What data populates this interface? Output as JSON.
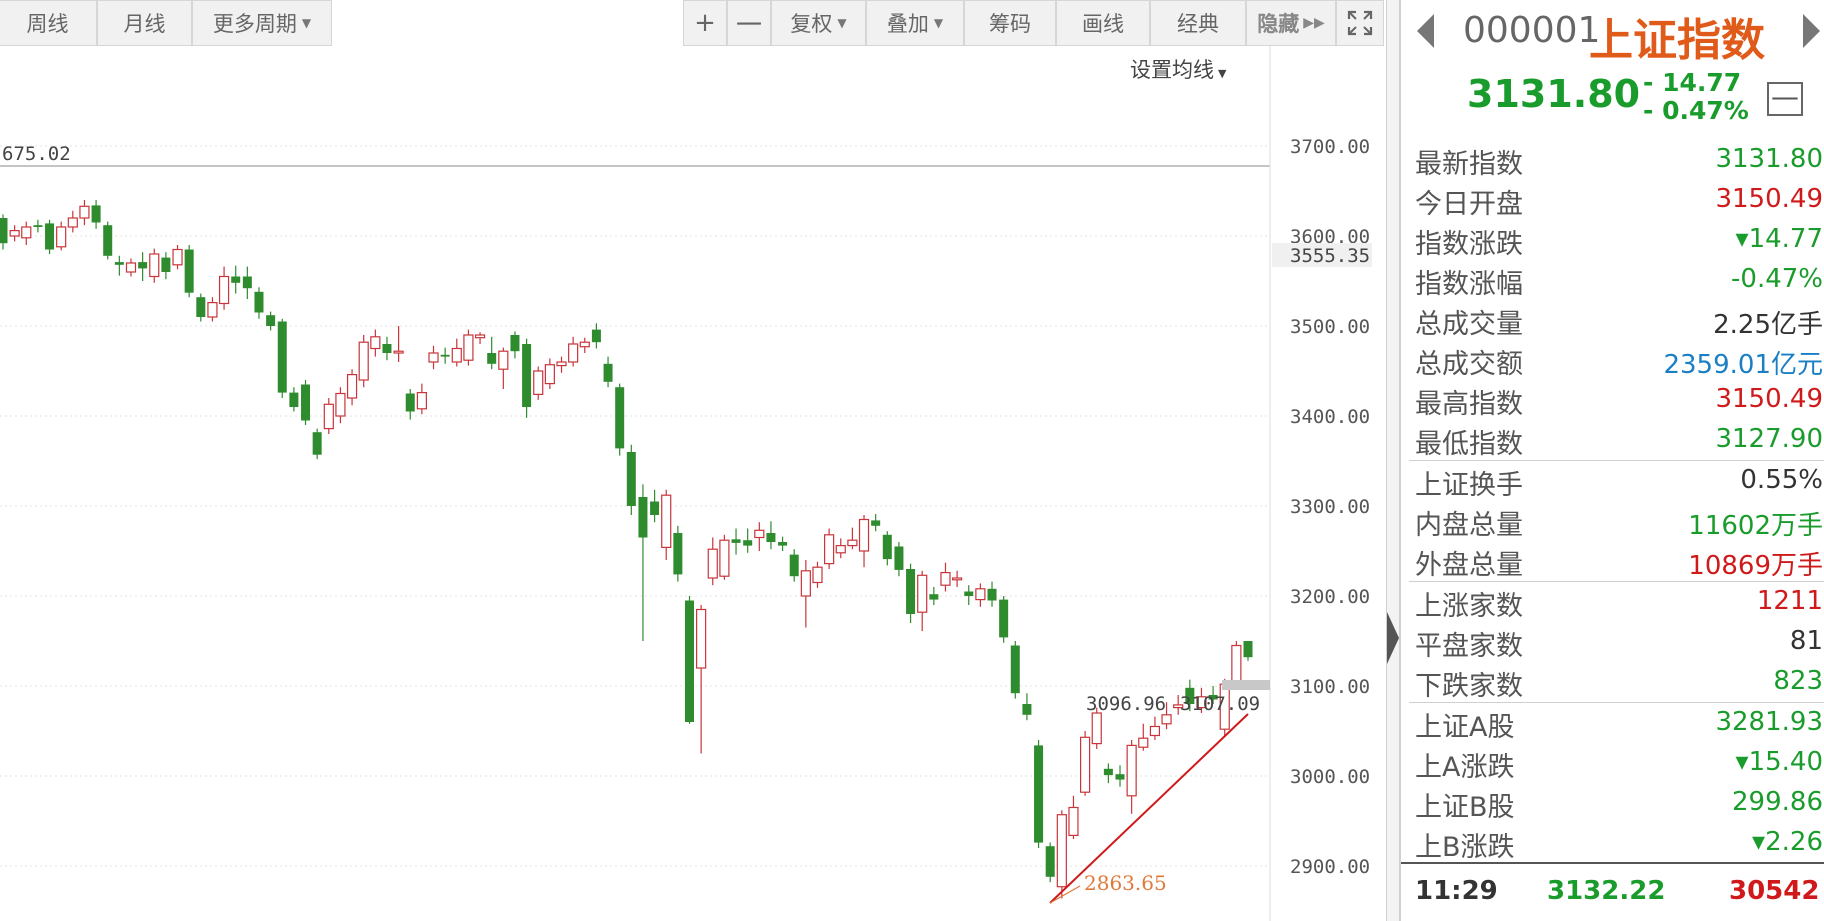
{
  "toolbar": {
    "weekly": "周线",
    "monthly": "月线",
    "more_periods": "更多周期",
    "zoom_in": "+",
    "zoom_out": "一",
    "fuquan": "复权",
    "overlay": "叠加",
    "chouma": "筹码",
    "huaxian": "画线",
    "jingdian": "经典",
    "hide": "隐藏",
    "set_ma": "设置均线"
  },
  "chart_data": {
    "type": "candlestick",
    "y_ticks": [
      "3700.00",
      "3600.00",
      "3500.00",
      "3400.00",
      "3300.00",
      "3200.00",
      "3100.00",
      "3000.00",
      "2900.00"
    ],
    "ylim": [
      2850,
      3720
    ],
    "annotations": {
      "high_label": "675.02",
      "current_cursor": "3555.35",
      "low_label": "2863.65",
      "label_a": "3096.96",
      "label_b": "3107.09"
    },
    "candles": [
      {
        "o": 3620,
        "c": 3592,
        "h": 3624,
        "l": 3585
      },
      {
        "o": 3600,
        "c": 3606,
        "h": 3612,
        "l": 3594
      },
      {
        "o": 3598,
        "c": 3610,
        "h": 3616,
        "l": 3590
      },
      {
        "o": 3612,
        "c": 3610,
        "h": 3618,
        "l": 3604
      },
      {
        "o": 3614,
        "c": 3585,
        "h": 3618,
        "l": 3580
      },
      {
        "o": 3588,
        "c": 3610,
        "h": 3616,
        "l": 3584
      },
      {
        "o": 3610,
        "c": 3620,
        "h": 3628,
        "l": 3604
      },
      {
        "o": 3620,
        "c": 3633,
        "h": 3640,
        "l": 3612
      },
      {
        "o": 3634,
        "c": 3615,
        "h": 3640,
        "l": 3608
      },
      {
        "o": 3612,
        "c": 3578,
        "h": 3616,
        "l": 3574
      },
      {
        "o": 3571,
        "c": 3568,
        "h": 3578,
        "l": 3556
      },
      {
        "o": 3560,
        "c": 3570,
        "h": 3575,
        "l": 3555
      },
      {
        "o": 3571,
        "c": 3564,
        "h": 3582,
        "l": 3550
      },
      {
        "o": 3555,
        "c": 3580,
        "h": 3586,
        "l": 3548
      },
      {
        "o": 3576,
        "c": 3560,
        "h": 3582,
        "l": 3552
      },
      {
        "o": 3568,
        "c": 3585,
        "h": 3590,
        "l": 3563
      },
      {
        "o": 3585,
        "c": 3537,
        "h": 3590,
        "l": 3532
      },
      {
        "o": 3532,
        "c": 3510,
        "h": 3536,
        "l": 3505
      },
      {
        "o": 3510,
        "c": 3526,
        "h": 3532,
        "l": 3505
      },
      {
        "o": 3525,
        "c": 3555,
        "h": 3566,
        "l": 3518
      },
      {
        "o": 3555,
        "c": 3548,
        "h": 3567,
        "l": 3536
      },
      {
        "o": 3555,
        "c": 3542,
        "h": 3566,
        "l": 3530
      },
      {
        "o": 3538,
        "c": 3515,
        "h": 3543,
        "l": 3508
      },
      {
        "o": 3512,
        "c": 3500,
        "h": 3516,
        "l": 3495
      },
      {
        "o": 3505,
        "c": 3426,
        "h": 3508,
        "l": 3420
      },
      {
        "o": 3426,
        "c": 3410,
        "h": 3432,
        "l": 3405
      },
      {
        "o": 3435,
        "c": 3395,
        "h": 3440,
        "l": 3390
      },
      {
        "o": 3382,
        "c": 3357,
        "h": 3386,
        "l": 3352
      },
      {
        "o": 3386,
        "c": 3413,
        "h": 3420,
        "l": 3380
      },
      {
        "o": 3400,
        "c": 3425,
        "h": 3432,
        "l": 3392
      },
      {
        "o": 3420,
        "c": 3446,
        "h": 3452,
        "l": 3412
      },
      {
        "o": 3440,
        "c": 3482,
        "h": 3490,
        "l": 3432
      },
      {
        "o": 3475,
        "c": 3488,
        "h": 3496,
        "l": 3466
      },
      {
        "o": 3480,
        "c": 3470,
        "h": 3488,
        "l": 3462
      },
      {
        "o": 3470,
        "c": 3472,
        "h": 3500,
        "l": 3460
      },
      {
        "o": 3425,
        "c": 3405,
        "h": 3430,
        "l": 3396
      },
      {
        "o": 3408,
        "c": 3426,
        "h": 3436,
        "l": 3402
      },
      {
        "o": 3460,
        "c": 3470,
        "h": 3478,
        "l": 3452
      },
      {
        "o": 3468,
        "c": 3466,
        "h": 3476,
        "l": 3458
      },
      {
        "o": 3460,
        "c": 3475,
        "h": 3486,
        "l": 3455
      },
      {
        "o": 3462,
        "c": 3490,
        "h": 3496,
        "l": 3456
      },
      {
        "o": 3487,
        "c": 3490,
        "h": 3493,
        "l": 3480
      },
      {
        "o": 3470,
        "c": 3458,
        "h": 3488,
        "l": 3452
      },
      {
        "o": 3452,
        "c": 3472,
        "h": 3476,
        "l": 3430
      },
      {
        "o": 3490,
        "c": 3472,
        "h": 3494,
        "l": 3464
      },
      {
        "o": 3480,
        "c": 3410,
        "h": 3486,
        "l": 3398
      },
      {
        "o": 3424,
        "c": 3450,
        "h": 3455,
        "l": 3418
      },
      {
        "o": 3436,
        "c": 3457,
        "h": 3464,
        "l": 3430
      },
      {
        "o": 3456,
        "c": 3460,
        "h": 3466,
        "l": 3448
      },
      {
        "o": 3460,
        "c": 3480,
        "h": 3488,
        "l": 3455
      },
      {
        "o": 3477,
        "c": 3482,
        "h": 3487,
        "l": 3470
      },
      {
        "o": 3496,
        "c": 3482,
        "h": 3503,
        "l": 3475
      },
      {
        "o": 3458,
        "c": 3438,
        "h": 3466,
        "l": 3432
      },
      {
        "o": 3432,
        "c": 3364,
        "h": 3436,
        "l": 3356
      },
      {
        "o": 3360,
        "c": 3300,
        "h": 3368,
        "l": 3290
      },
      {
        "o": 3310,
        "c": 3265,
        "h": 3324,
        "l": 3150
      },
      {
        "o": 3305,
        "c": 3290,
        "h": 3318,
        "l": 3282
      },
      {
        "o": 3254,
        "c": 3312,
        "h": 3318,
        "l": 3240
      },
      {
        "o": 3270,
        "c": 3224,
        "h": 3278,
        "l": 3216
      },
      {
        "o": 3195,
        "c": 3060,
        "h": 3200,
        "l": 3058
      },
      {
        "o": 3120,
        "c": 3185,
        "h": 3190,
        "l": 3025
      },
      {
        "o": 3220,
        "c": 3252,
        "h": 3265,
        "l": 3212
      },
      {
        "o": 3222,
        "c": 3262,
        "h": 3268,
        "l": 3218
      },
      {
        "o": 3263,
        "c": 3259,
        "h": 3275,
        "l": 3246
      },
      {
        "o": 3262,
        "c": 3256,
        "h": 3275,
        "l": 3248
      },
      {
        "o": 3265,
        "c": 3273,
        "h": 3282,
        "l": 3250
      },
      {
        "o": 3270,
        "c": 3260,
        "h": 3283,
        "l": 3252
      },
      {
        "o": 3260,
        "c": 3256,
        "h": 3266,
        "l": 3250
      },
      {
        "o": 3246,
        "c": 3222,
        "h": 3252,
        "l": 3216
      },
      {
        "o": 3200,
        "c": 3228,
        "h": 3240,
        "l": 3165
      },
      {
        "o": 3215,
        "c": 3232,
        "h": 3238,
        "l": 3209
      },
      {
        "o": 3236,
        "c": 3268,
        "h": 3275,
        "l": 3230
      },
      {
        "o": 3248,
        "c": 3256,
        "h": 3264,
        "l": 3242
      },
      {
        "o": 3256,
        "c": 3262,
        "h": 3276,
        "l": 3252
      },
      {
        "o": 3250,
        "c": 3285,
        "h": 3290,
        "l": 3232
      },
      {
        "o": 3284,
        "c": 3278,
        "h": 3291,
        "l": 3272
      },
      {
        "o": 3268,
        "c": 3241,
        "h": 3272,
        "l": 3234
      },
      {
        "o": 3255,
        "c": 3229,
        "h": 3260,
        "l": 3222
      },
      {
        "o": 3230,
        "c": 3180,
        "h": 3236,
        "l": 3170
      },
      {
        "o": 3182,
        "c": 3223,
        "h": 3228,
        "l": 3161
      },
      {
        "o": 3202,
        "c": 3196,
        "h": 3210,
        "l": 3190
      },
      {
        "o": 3212,
        "c": 3226,
        "h": 3237,
        "l": 3205
      },
      {
        "o": 3218,
        "c": 3220,
        "h": 3228,
        "l": 3210
      },
      {
        "o": 3205,
        "c": 3200,
        "h": 3212,
        "l": 3190
      },
      {
        "o": 3196,
        "c": 3208,
        "h": 3214,
        "l": 3188
      },
      {
        "o": 3208,
        "c": 3195,
        "h": 3216,
        "l": 3188
      },
      {
        "o": 3196,
        "c": 3154,
        "h": 3200,
        "l": 3148
      },
      {
        "o": 3145,
        "c": 3092,
        "h": 3150,
        "l": 3086
      },
      {
        "o": 3080,
        "c": 3068,
        "h": 3092,
        "l": 3062
      },
      {
        "o": 3034,
        "c": 2926,
        "h": 3040,
        "l": 2920
      },
      {
        "o": 2922,
        "c": 2888,
        "h": 2926,
        "l": 2882
      },
      {
        "o": 2877,
        "c": 2957,
        "h": 2962,
        "l": 2864
      },
      {
        "o": 2934,
        "c": 2965,
        "h": 2978,
        "l": 2930
      },
      {
        "o": 2982,
        "c": 3043,
        "h": 3050,
        "l": 2978
      },
      {
        "o": 3036,
        "c": 3070,
        "h": 3076,
        "l": 3030
      },
      {
        "o": 3008,
        "c": 3001,
        "h": 3014,
        "l": 2992
      },
      {
        "o": 3002,
        "c": 2996,
        "h": 3012,
        "l": 2988
      },
      {
        "o": 2978,
        "c": 3034,
        "h": 3040,
        "l": 2958
      },
      {
        "o": 3032,
        "c": 3042,
        "h": 3058,
        "l": 3028
      },
      {
        "o": 3045,
        "c": 3055,
        "h": 3066,
        "l": 3040
      },
      {
        "o": 3058,
        "c": 3068,
        "h": 3082,
        "l": 3052
      },
      {
        "o": 3076,
        "c": 3079,
        "h": 3090,
        "l": 3068
      },
      {
        "o": 3098,
        "c": 3080,
        "h": 3107,
        "l": 3072
      },
      {
        "o": 3076,
        "c": 3088,
        "h": 3098,
        "l": 3070
      },
      {
        "o": 3090,
        "c": 3085,
        "h": 3100,
        "l": 3080
      },
      {
        "o": 3052,
        "c": 3102,
        "h": 3108,
        "l": 3045
      },
      {
        "o": 3105,
        "c": 3145,
        "h": 3150,
        "l": 3100
      },
      {
        "o": 3150,
        "c": 3132,
        "h": 3150,
        "l": 3128
      }
    ]
  },
  "quote": {
    "code": "000001",
    "name": "上证指数",
    "last": "3131.80",
    "change_abs": "- 14.77",
    "change_pct": "- 0.47%",
    "minus": "—",
    "rows": [
      {
        "label": "最新指数",
        "value": "3131.80",
        "color": "#1a9c2c"
      },
      {
        "label": "今日开盘",
        "value": "3150.49",
        "color": "#d0191a"
      },
      {
        "label": "指数涨跌",
        "value": "▾14.77",
        "color": "#1a9c2c"
      },
      {
        "label": "指数涨幅",
        "value": "-0.47%",
        "color": "#1a9c2c"
      },
      {
        "label": "总成交量",
        "value": "2.25亿手",
        "color": "#333333"
      },
      {
        "label": "总成交额",
        "value": "2359.01亿元",
        "color": "#1a7fc4"
      },
      {
        "label": "最高指数",
        "value": "3150.49",
        "color": "#d0191a"
      },
      {
        "label": "最低指数",
        "value": "3127.90",
        "color": "#1a9c2c"
      },
      {
        "label": "上证换手",
        "value": "0.55%",
        "color": "#333333"
      },
      {
        "label": "内盘总量",
        "value": "11602万手",
        "color": "#1a9c2c"
      },
      {
        "label": "外盘总量",
        "value": "10869万手",
        "color": "#d0191a"
      },
      {
        "label": "上涨家数",
        "value": "1211",
        "color": "#d0191a"
      },
      {
        "label": "平盘家数",
        "value": "81",
        "color": "#333333"
      },
      {
        "label": "下跌家数",
        "value": "823",
        "color": "#1a9c2c"
      },
      {
        "label": "上证A股",
        "value": "3281.93",
        "color": "#1a9c2c"
      },
      {
        "label": "上A涨跌",
        "value": "▾15.40",
        "color": "#1a9c2c"
      },
      {
        "label": "上证B股",
        "value": "299.86",
        "color": "#1a9c2c"
      },
      {
        "label": "上B涨跌",
        "value": "▾2.26",
        "color": "#1a9c2c"
      }
    ],
    "tick": {
      "time": "11:29",
      "price": "3132.22",
      "volume": "30542"
    }
  },
  "colors": {
    "up": "#c8343a",
    "down": "#2e8b2e",
    "trend": "#d0191a",
    "low_label": "#e07a3a"
  }
}
